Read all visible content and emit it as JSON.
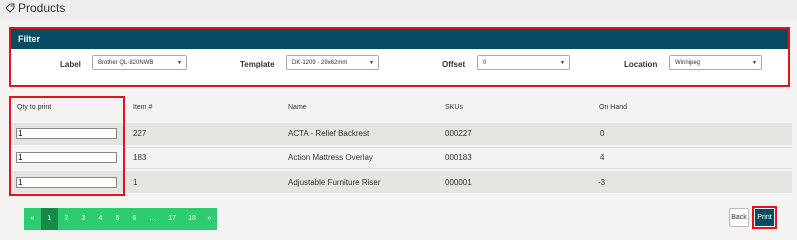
{
  "page": {
    "title": "Products"
  },
  "filter": {
    "heading": "Filter",
    "label_label": "Label",
    "label_value": "Brother QL-820NWB",
    "template_label": "Template",
    "template_value": "DK-1209 - 29x62mm",
    "offset_label": "Offset",
    "offset_value": "0",
    "location_label": "Location",
    "location_value": "Winnipeg"
  },
  "table": {
    "headers": [
      "Qty to print",
      "Item #",
      "Name",
      "SKUs",
      "On Hand"
    ],
    "rows": [
      {
        "qty": "1",
        "item": "227",
        "name": "ACTA - Relief Backrest",
        "sku": "000227",
        "on_hand": "0"
      },
      {
        "qty": "1",
        "item": "183",
        "name": "Action Mattress Overlay",
        "sku": "000183",
        "on_hand": "4"
      },
      {
        "qty": "1",
        "item": "1",
        "name": "Adjustable Furniture Riser",
        "sku": "000001",
        "on_hand": "-3"
      }
    ]
  },
  "pagination": {
    "prev": "«",
    "pages": [
      "1",
      "2",
      "3",
      "4",
      "5",
      "6",
      "...",
      "17",
      "18"
    ],
    "next": "»",
    "current": "1"
  },
  "buttons": {
    "back": "Back",
    "print": "Print"
  },
  "colors": {
    "accent": "#084c61",
    "highlight": "#e0141e",
    "pager": "#2ecc71"
  },
  "icons": {
    "title_icon": "tag-icon"
  }
}
